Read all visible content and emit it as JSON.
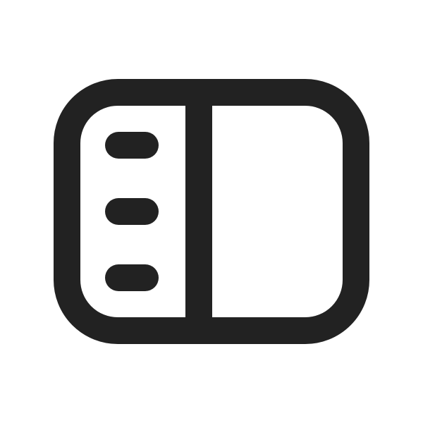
{
  "icon": {
    "name": "sidebar-panel-icon",
    "stroke_color": "#222222",
    "background_color": "#ffffff",
    "list_lines_count": 3
  }
}
